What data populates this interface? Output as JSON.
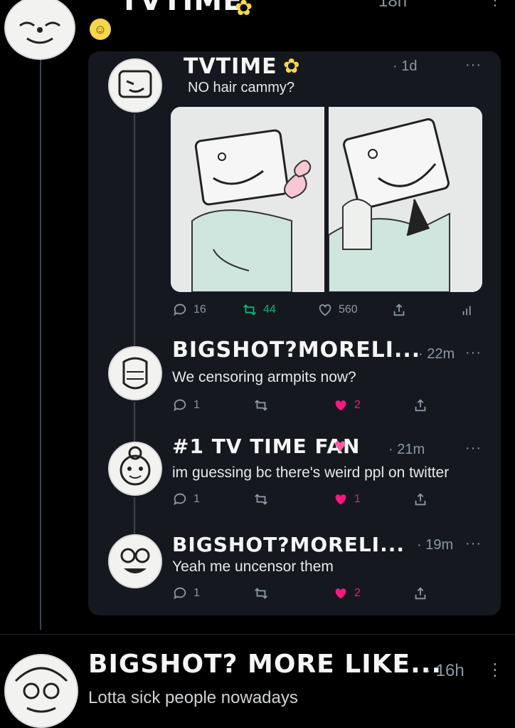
{
  "top": {
    "author": "TVTIME",
    "time": "18h"
  },
  "quoted_post": {
    "author": "TVTIME",
    "time": "· 1d",
    "text": "NO hair cammy?",
    "actions": {
      "replies": "16",
      "reposts": "44",
      "likes": "560"
    }
  },
  "replies": [
    {
      "author": "BIGSHOT?MORELI...",
      "time": "· 22m",
      "text": "We censoring armpits now?",
      "reply_count": "1",
      "like_count": "2"
    },
    {
      "author": "#1 TV TIME FAN",
      "time": "· 21m",
      "text": "im guessing bc there's weird ppl on twitter",
      "reply_count": "1",
      "like_count": "1"
    },
    {
      "author": "BIGSHOT?MORELI...",
      "time": "· 19m",
      "text": "Yeah me uncensor them",
      "reply_count": "1",
      "like_count": "2"
    }
  ],
  "bottom_post": {
    "author": "BIGSHOT? MORE LIKE...",
    "time": "· 16h",
    "text": "Lotta sick people nowadays"
  },
  "colors": {
    "background": "#000000",
    "card": "#15181f",
    "accent_green": "#00ba7c",
    "like_pink": "#f91880",
    "star_yellow": "#f7d64a"
  }
}
